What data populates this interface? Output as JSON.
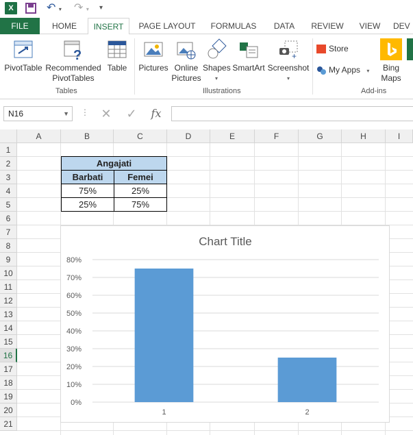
{
  "qat": {
    "app_icon": "X",
    "save_icon": "save-icon",
    "undo_icon": "undo-icon",
    "redo_icon": "redo-icon"
  },
  "tabs": [
    {
      "label": "FILE"
    },
    {
      "label": "HOME"
    },
    {
      "label": "INSERT"
    },
    {
      "label": "PAGE LAYOUT"
    },
    {
      "label": "FORMULAS"
    },
    {
      "label": "DATA"
    },
    {
      "label": "REVIEW"
    },
    {
      "label": "VIEW"
    },
    {
      "label": "DEV"
    }
  ],
  "ribbon": {
    "tables": {
      "pivottable": "PivotTable",
      "recommended1": "Recommended",
      "recommended2": "PivotTables",
      "table": "Table",
      "group": "Tables"
    },
    "illustrations": {
      "pictures": "Pictures",
      "online1": "Online",
      "online2": "Pictures",
      "shapes": "Shapes",
      "smartart": "SmartArt",
      "screenshot": "Screenshot",
      "group": "Illustrations"
    },
    "addins": {
      "store": "Store",
      "myapps": "My Apps",
      "bing1": "Bing",
      "bing2": "Maps",
      "group": "Add-ins"
    }
  },
  "formula_bar": {
    "name_box": "N16",
    "fx": "fx"
  },
  "columns": [
    "A",
    "B",
    "C",
    "D",
    "E",
    "F",
    "G",
    "H",
    "I"
  ],
  "rows": [
    "1",
    "2",
    "3",
    "4",
    "5",
    "6",
    "7",
    "8",
    "9",
    "10",
    "11",
    "12",
    "13",
    "14",
    "15",
    "16",
    "17",
    "18",
    "19",
    "20",
    "21"
  ],
  "active_row": "16",
  "table": {
    "title": "Angajati",
    "headers": [
      "Barbati",
      "Femei"
    ],
    "rows": [
      [
        "75%",
        "25%"
      ],
      [
        "25%",
        "75%"
      ]
    ]
  },
  "colors": {
    "accent": "#217346",
    "bar": "#5b9bd5",
    "header_fill": "#bdd7ee"
  },
  "chart_data": {
    "type": "bar",
    "title": "Chart Title",
    "categories": [
      "1",
      "2"
    ],
    "values": [
      0.75,
      0.25
    ],
    "yticks": [
      "0%",
      "10%",
      "20%",
      "30%",
      "40%",
      "50%",
      "60%",
      "70%",
      "80%"
    ],
    "ylim": [
      0,
      0.8
    ],
    "grid": true,
    "legend": "none"
  }
}
